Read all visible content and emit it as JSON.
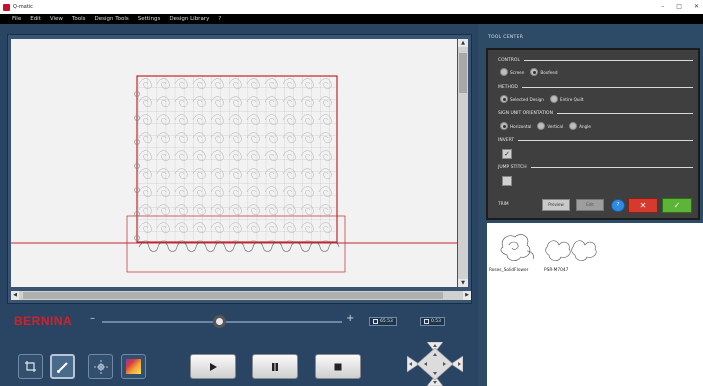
{
  "window": {
    "title": "Q-matic",
    "controls": [
      "–",
      "□",
      "✕"
    ]
  },
  "menu": [
    "File",
    "Edit",
    "View",
    "Tools",
    "Design Tools",
    "Settings",
    "Design Library",
    "?"
  ],
  "canvas": {
    "scroll_up": "▲",
    "scroll_down": "▼",
    "scroll_left": "◀",
    "scroll_right": "▶"
  },
  "zoom": {
    "brand": "BERNINA",
    "minus": "–",
    "plus": "+",
    "level": 0.5,
    "coord_x": "65.53",
    "coord_y": "0.53"
  },
  "tool_center": {
    "title": "TOOL CENTER",
    "sections": {
      "control": {
        "label": "CONTROL",
        "options": [
          "Screen",
          "Boxfeed"
        ],
        "selected": 1
      },
      "method": {
        "label": "METHOD",
        "options": [
          "Selected Design",
          "Entire Quilt"
        ],
        "selected": 0
      },
      "orientation": {
        "label": "SIGN UNIT ORIENTATION",
        "options": [
          "Horizontal",
          "Vertical",
          "Angle"
        ],
        "selected": 0
      },
      "invert": {
        "label": "INVERT",
        "checked": true,
        "mark": "✓"
      },
      "jump": {
        "label": "JUMP STITCH",
        "checked": false,
        "mark": ""
      }
    },
    "buttons": {
      "label": "TRIM",
      "preview": "Preview",
      "edit": "Edit",
      "help": "?",
      "cancel": "✕",
      "ok": "✓"
    }
  },
  "library": {
    "items": [
      {
        "name": "Roses_SolidFlower"
      },
      {
        "name": "PSR-M7047"
      }
    ]
  },
  "colors": {
    "border_red": "#c0282d",
    "brand_red": "#d4202a",
    "ok_green": "#5cb536",
    "cancel_red": "#d63a2f",
    "help_blue": "#2f8be0"
  }
}
